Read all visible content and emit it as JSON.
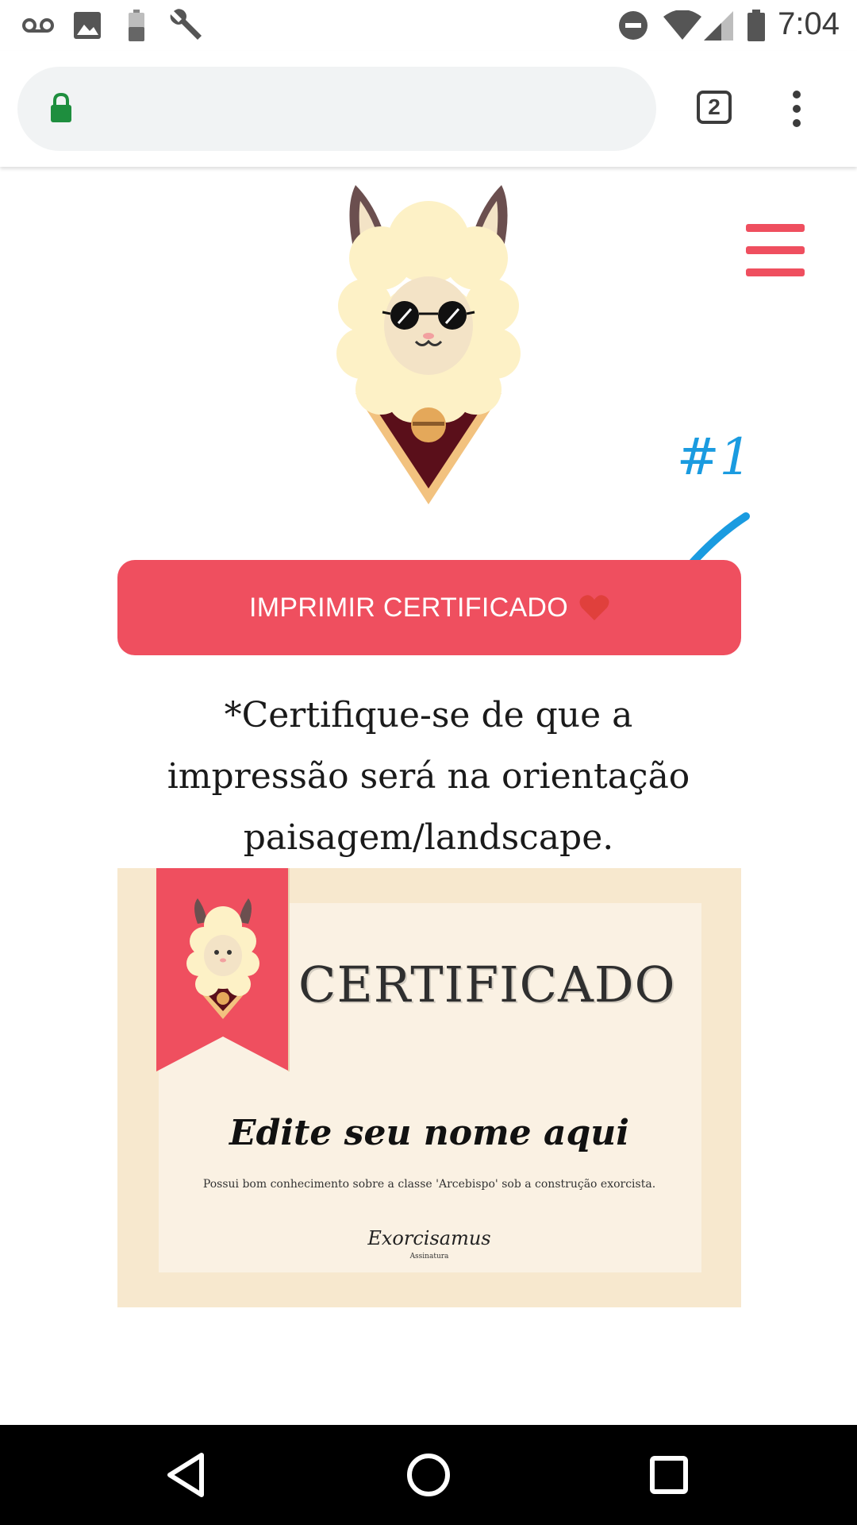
{
  "status_bar": {
    "time": "7:04",
    "icons": [
      "voicemail-icon",
      "image-icon",
      "battery-low-icon",
      "wrench-icon",
      "do-not-disturb-icon",
      "wifi-icon",
      "signal-icon",
      "battery-icon"
    ]
  },
  "browser": {
    "url": "",
    "tab_count": "2",
    "icons": [
      "lock-icon",
      "more-vert-icon"
    ]
  },
  "page": {
    "print_button_label": "IMPRIMIR CERTIFICADO",
    "note": "*Certifique-se de que a impressão será na orientação paisagem/landscape.",
    "annotation_text": "#1"
  },
  "certificate": {
    "title": "CERTIFICADO",
    "name_placeholder": "Edite seu nome aqui",
    "description": "Possui bom conhecimento sobre a classe 'Arcebispo' sob a construção exorcista.",
    "signature": "Exorcisamus",
    "signature_label": "Assinatura"
  },
  "colors": {
    "accent": "#ef4f5f",
    "cert_outer": "#f7e8ce",
    "cert_inner": "#faf1e3",
    "annotation": "#1a9be0"
  },
  "nav_bar": {
    "icons": [
      "back-icon",
      "home-icon",
      "recents-icon"
    ]
  }
}
